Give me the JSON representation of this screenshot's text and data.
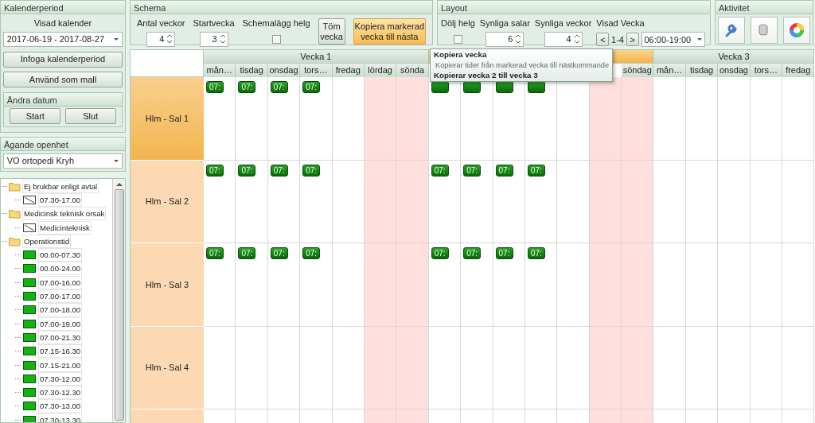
{
  "calendar_panel": {
    "title": "Kalenderperiod",
    "label": "Visad kalender",
    "calendar_select": "2017-06-19 - 2017-08-27",
    "buttons": [
      "Infoga kalenderperiod",
      "Använd som mall"
    ],
    "date_group": {
      "title": "Ändra datum",
      "buttons": [
        "Start",
        "Slut"
      ]
    }
  },
  "owner_panel": {
    "title": "Ägande openhet",
    "unit_select": "VO ortopedi Kryh"
  },
  "tree": [
    {
      "label": "Ej brukbar enligt avtal",
      "children": [
        {
          "label": "07.30-17.00",
          "kind": "blocked"
        }
      ]
    },
    {
      "label": "Medicinsk teknisk orsak",
      "children": [
        {
          "label": "Medicinteknisk",
          "kind": "blocked"
        }
      ]
    },
    {
      "label": "Operationstid",
      "children": [
        {
          "label": "00.00-07.30",
          "kind": "operation"
        },
        {
          "label": "00.00-24.00",
          "kind": "operation"
        },
        {
          "label": "07.00-16.00",
          "kind": "operation"
        },
        {
          "label": "07.00-17.00",
          "kind": "operation"
        },
        {
          "label": "07.00-18.00",
          "kind": "operation"
        },
        {
          "label": "07.00-19.00",
          "kind": "operation"
        },
        {
          "label": "07.00-21.30",
          "kind": "operation"
        },
        {
          "label": "07.15-16.30",
          "kind": "operation"
        },
        {
          "label": "07.15-21.00",
          "kind": "operation"
        },
        {
          "label": "07.30-12.00",
          "kind": "operation"
        },
        {
          "label": "07.30-12.30",
          "kind": "operation"
        },
        {
          "label": "07.30-13.00",
          "kind": "operation"
        },
        {
          "label": "07.30-13.30",
          "kind": "operation"
        }
      ]
    }
  ],
  "schema": {
    "title": "Schema",
    "weeks_label": "Antal veckor",
    "weeks_value": "4",
    "start_label": "Startvecka",
    "start_value": "3",
    "weekend_label": "Schemalägg helg",
    "weekend_checked": false,
    "buttons": [
      {
        "label": "Töm vecka",
        "highlighted": false
      },
      {
        "label": "Kopiera markerad vecka till nästa",
        "highlighted": true
      }
    ]
  },
  "layout": {
    "title": "Layout",
    "hide_weekend_label": "Dölj helg",
    "hide_weekend_checked": false,
    "rooms_label": "Synliga salar",
    "rooms_value": "6",
    "weeks_label": "Synliga veckor",
    "weeks_value": "4",
    "shown_week_label": "Visad Vecka",
    "prev": "<",
    "range": "1-4",
    "next": ">",
    "time_select": "06:00-19:00"
  },
  "activity": {
    "title": "Aktivitet"
  },
  "schedule": {
    "weeks": [
      {
        "title": "Vecka 1",
        "selected": false,
        "days": [
          {
            "label": "mån…",
            "weekend": false
          },
          {
            "label": "tisdag",
            "weekend": false
          },
          {
            "label": "onsdag",
            "weekend": false
          },
          {
            "label": "tors…",
            "weekend": false
          },
          {
            "label": "fredag",
            "weekend": false
          },
          {
            "label": "lördag",
            "weekend": true
          },
          {
            "label": "sönda",
            "weekend": true
          }
        ]
      },
      {
        "selected": true,
        "days": [
          {
            "weekend": false
          },
          {
            "weekend": false
          },
          {
            "weekend": false
          },
          {
            "weekend": false
          },
          {
            "weekend": false
          },
          {
            "weekend": true
          },
          {
            "label": "söndag",
            "weekend": true
          }
        ]
      },
      {
        "title": "Vecka 3",
        "selected": false,
        "days": [
          {
            "label": "mån…",
            "weekend": false
          },
          {
            "label": "tisdag",
            "weekend": false
          },
          {
            "label": "onsdag",
            "weekend": false
          },
          {
            "label": "tors…",
            "weekend": false
          },
          {
            "label": "fredag",
            "weekend": false
          }
        ]
      }
    ],
    "rooms": [
      {
        "name": "Hlm - Sal 1",
        "selected": true,
        "weeks": [
          [
            {
              "booked": true,
              "label": "07:"
            },
            {
              "booked": true,
              "label": "07:"
            },
            {
              "booked": true,
              "label": "07:"
            },
            {
              "booked": true,
              "label": "07:"
            },
            {
              "booked": false
            },
            {
              "booked": false
            },
            {
              "booked": false
            }
          ],
          [
            {
              "booked": true
            },
            {
              "booked": true
            },
            {
              "booked": true
            },
            {
              "booked": true
            },
            {
              "booked": false
            },
            {
              "booked": false
            },
            {
              "booked": false
            }
          ],
          [
            {
              "booked": false
            },
            {
              "booked": false
            },
            {
              "booked": false
            },
            {
              "booked": false
            },
            {
              "booked": false
            }
          ]
        ]
      },
      {
        "name": "Hlm - Sal 2",
        "selected": false,
        "weeks": [
          [
            {
              "booked": true,
              "label": "07:"
            },
            {
              "booked": true,
              "label": "07:"
            },
            {
              "booked": true,
              "label": "07:"
            },
            {
              "booked": true,
              "label": "07:"
            },
            {
              "booked": false
            },
            {
              "booked": false
            },
            {
              "booked": false
            }
          ],
          [
            {
              "booked": true,
              "label": "07:"
            },
            {
              "booked": true,
              "label": "07:"
            },
            {
              "booked": true,
              "label": "07:"
            },
            {
              "booked": true,
              "label": "07:"
            },
            {
              "booked": false
            },
            {
              "booked": false
            },
            {
              "booked": false
            }
          ],
          [
            {
              "booked": false
            },
            {
              "booked": false
            },
            {
              "booked": false
            },
            {
              "booked": false
            },
            {
              "booked": false
            }
          ]
        ]
      },
      {
        "name": "Hlm - Sal 3",
        "selected": false,
        "weeks": [
          [
            {
              "booked": true,
              "label": "07:"
            },
            {
              "booked": true,
              "label": "07:"
            },
            {
              "booked": true,
              "label": "07:"
            },
            {
              "booked": true,
              "label": "07:"
            },
            {
              "booked": false
            },
            {
              "booked": false
            },
            {
              "booked": false
            }
          ],
          [
            {
              "booked": true,
              "label": "07:"
            },
            {
              "booked": true,
              "label": "07:"
            },
            {
              "booked": true,
              "label": "07:"
            },
            {
              "booked": true,
              "label": "07:"
            },
            {
              "booked": false
            },
            {
              "booked": false
            },
            {
              "booked": false
            }
          ],
          [
            {
              "booked": false
            },
            {
              "booked": false
            },
            {
              "booked": false
            },
            {
              "booked": false
            },
            {
              "booked": false
            }
          ]
        ]
      },
      {
        "name": "Hlm - Sal 4",
        "selected": false,
        "weeks": [
          [
            {
              "booked": false
            },
            {
              "booked": false
            },
            {
              "booked": false
            },
            {
              "booked": false
            },
            {
              "booked": false
            },
            {
              "booked": false
            },
            {
              "booked": false
            }
          ],
          [
            {
              "booked": false
            },
            {
              "booked": false
            },
            {
              "booked": false
            },
            {
              "booked": false
            },
            {
              "booked": false
            },
            {
              "booked": false
            },
            {
              "booked": false
            }
          ],
          [
            {
              "booked": false
            },
            {
              "booked": false
            },
            {
              "booked": false
            },
            {
              "booked": false
            },
            {
              "booked": false
            }
          ]
        ]
      },
      {
        "selected": false,
        "weeks": [
          [
            {
              "booked": false
            },
            {
              "booked": false
            },
            {
              "booked": false
            },
            {
              "booked": false
            },
            {
              "booked": false
            },
            {
              "booked": false
            },
            {
              "booked": false
            }
          ],
          [
            {
              "booked": false
            },
            {
              "booked": false
            },
            {
              "booked": false
            },
            {
              "booked": false
            },
            {
              "booked": false
            },
            {
              "booked": false
            },
            {
              "booked": false
            }
          ],
          [
            {
              "booked": false
            },
            {
              "booked": false
            },
            {
              "booked": false
            },
            {
              "booked": false
            },
            {
              "booked": false
            }
          ]
        ]
      }
    ]
  },
  "tooltip": {
    "title": "Kopiera vecka",
    "text": "Kopierar tider från markerad vecka till nästkommande",
    "footer": "Kopierar vecka 2 till vecka 3"
  }
}
